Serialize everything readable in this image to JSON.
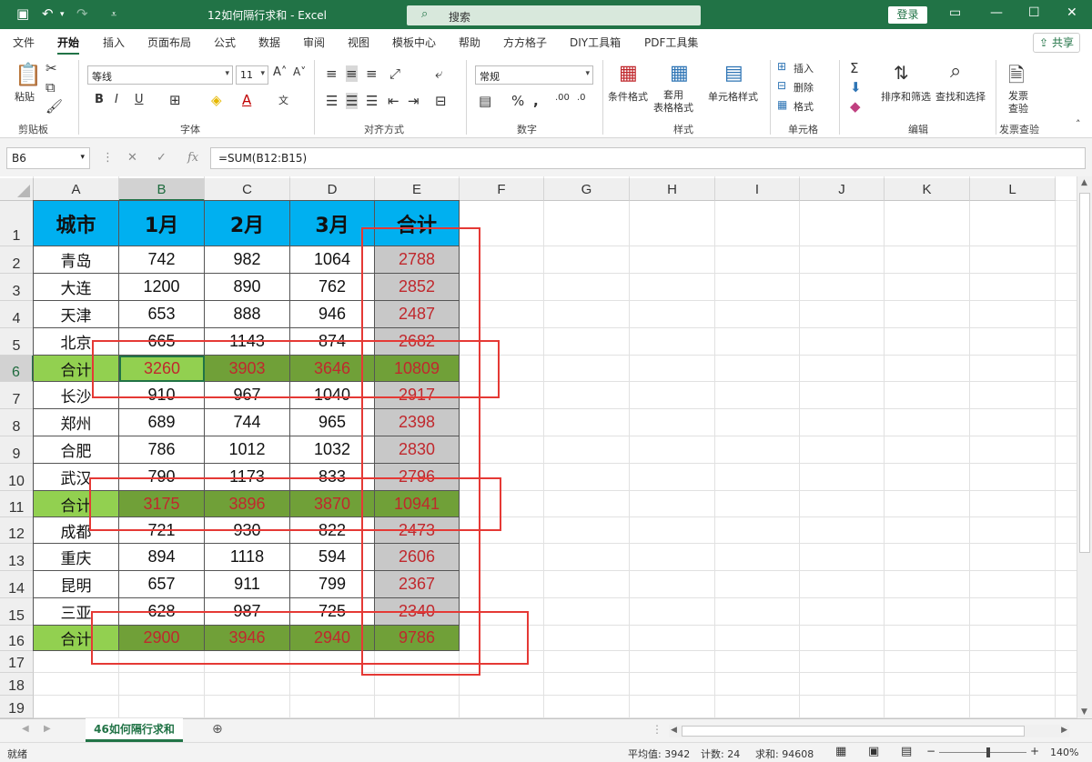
{
  "titlebar": {
    "title": "12如何隔行求和  -  Excel",
    "search_placeholder": "搜索",
    "login_label": "登录"
  },
  "tabs": [
    "文件",
    "开始",
    "插入",
    "页面布局",
    "公式",
    "数据",
    "审阅",
    "视图",
    "模板中心",
    "帮助",
    "方方格子",
    "DIY工具箱",
    "PDF工具集"
  ],
  "active_tab": "开始",
  "share_label": "共享",
  "ribbon": {
    "clipboard": {
      "paste": "粘贴",
      "group": "剪贴板"
    },
    "font": {
      "name": "等线",
      "size": "11",
      "bold": "B",
      "italic": "I",
      "underline": "U",
      "group": "字体"
    },
    "alignment": {
      "group": "对齐方式"
    },
    "number": {
      "format": "常规",
      "group": "数字"
    },
    "styles": {
      "conditional": "条件格式",
      "table": "套用\n表格格式",
      "cell_styles": "单元格样式",
      "group": "样式"
    },
    "cells": {
      "insert": "插入",
      "delete": "删除",
      "format": "格式",
      "group": "单元格"
    },
    "editing": {
      "sort": "排序和筛选",
      "find": "查找和选择",
      "group": "编辑"
    },
    "invoice": {
      "label1": "发票",
      "label2": "查验",
      "group": "发票查验"
    }
  },
  "formula_bar": {
    "name_box": "B6",
    "formula": "=SUM(B12:B15)"
  },
  "columns": [
    "A",
    "B",
    "C",
    "D",
    "E",
    "F",
    "G",
    "H",
    "I",
    "J",
    "K",
    "L"
  ],
  "rows": [
    "1",
    "2",
    "3",
    "4",
    "5",
    "6",
    "7",
    "8",
    "9",
    "10",
    "11",
    "12",
    "13",
    "14",
    "15",
    "16",
    "17",
    "18",
    "19"
  ],
  "selected_cell": {
    "col": "B",
    "row": "6"
  },
  "table": {
    "headers": [
      "城市",
      "1月",
      "2月",
      "3月",
      "合计"
    ],
    "rows": [
      {
        "city": "青岛",
        "m1": "742",
        "m2": "982",
        "m3": "1064",
        "total": "2788",
        "is_sum": false
      },
      {
        "city": "大连",
        "m1": "1200",
        "m2": "890",
        "m3": "762",
        "total": "2852",
        "is_sum": false
      },
      {
        "city": "天津",
        "m1": "653",
        "m2": "888",
        "m3": "946",
        "total": "2487",
        "is_sum": false
      },
      {
        "city": "北京",
        "m1": "665",
        "m2": "1143",
        "m3": "874",
        "total": "2682",
        "is_sum": false
      },
      {
        "city": "合计",
        "m1": "3260",
        "m2": "3903",
        "m3": "3646",
        "total": "10809",
        "is_sum": true
      },
      {
        "city": "长沙",
        "m1": "910",
        "m2": "967",
        "m3": "1040",
        "total": "2917",
        "is_sum": false
      },
      {
        "city": "郑州",
        "m1": "689",
        "m2": "744",
        "m3": "965",
        "total": "2398",
        "is_sum": false
      },
      {
        "city": "合肥",
        "m1": "786",
        "m2": "1012",
        "m3": "1032",
        "total": "2830",
        "is_sum": false
      },
      {
        "city": "武汉",
        "m1": "790",
        "m2": "1173",
        "m3": "833",
        "total": "2796",
        "is_sum": false
      },
      {
        "city": "合计",
        "m1": "3175",
        "m2": "3896",
        "m3": "3870",
        "total": "10941",
        "is_sum": true
      },
      {
        "city": "成都",
        "m1": "721",
        "m2": "930",
        "m3": "822",
        "total": "2473",
        "is_sum": false
      },
      {
        "city": "重庆",
        "m1": "894",
        "m2": "1118",
        "m3": "594",
        "total": "2606",
        "is_sum": false
      },
      {
        "city": "昆明",
        "m1": "657",
        "m2": "911",
        "m3": "799",
        "total": "2367",
        "is_sum": false
      },
      {
        "city": "三亚",
        "m1": "628",
        "m2": "987",
        "m3": "725",
        "total": "2340",
        "is_sum": false
      },
      {
        "city": "合计",
        "m1": "2900",
        "m2": "3946",
        "m3": "2940",
        "total": "9786",
        "is_sum": true
      }
    ]
  },
  "colors": {
    "header_fill": "#00b0f0",
    "sum_row_fill": "#70a038",
    "sum_label_fill": "#92d050",
    "total_col_fill": "#c8c8c8",
    "value_red": "#c0282d",
    "excel_green": "#217346",
    "annotation_red": "#e53935"
  },
  "sheet_tab": "46如何隔行求和",
  "status": {
    "ready": "就绪",
    "average": "平均值: 3942",
    "count": "计数: 24",
    "sum": "求和: 94608",
    "zoom": "140%"
  }
}
